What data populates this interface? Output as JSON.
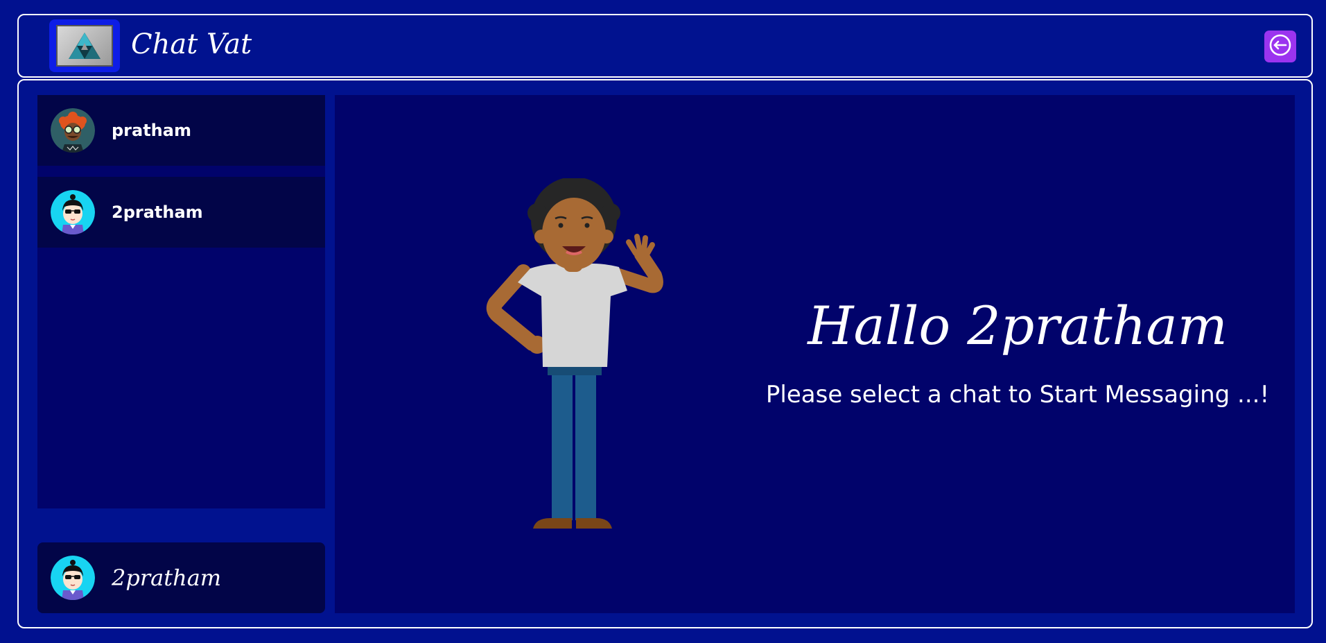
{
  "app": {
    "title": "Chat Vat"
  },
  "contacts": [
    {
      "name": "pratham",
      "avatar": "avatar-red-hair-icon"
    },
    {
      "name": "2pratham",
      "avatar": "avatar-sunglasses-icon"
    }
  ],
  "current_user": {
    "name": "2pratham",
    "avatar": "avatar-sunglasses-icon"
  },
  "welcome": {
    "greeting": "Hallo 2pratham",
    "message": "Please select a chat to Start Messaging ...!"
  },
  "icons": {
    "logo": "triangle-logo-icon",
    "logout": "logout-icon"
  },
  "colors": {
    "background": "#01118f",
    "panel": "#01036b",
    "item": "#020548",
    "logout_button": "#9b34ef",
    "border": "#ffffff"
  }
}
